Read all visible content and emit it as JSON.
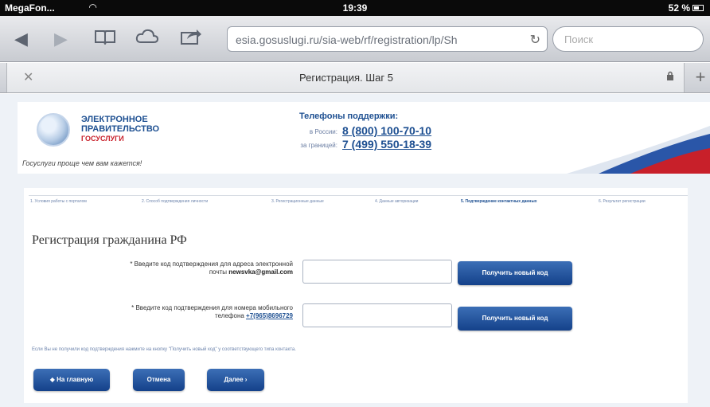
{
  "status_bar": {
    "carrier": "MegaFon...",
    "time": "19:39",
    "battery": "52 %"
  },
  "browser": {
    "url": "esia.gosuslugi.ru/sia-web/rf/registration/lp/Sh",
    "search_placeholder": "Поиск",
    "tab_title": "Регистрация. Шаг 5",
    "icons": [
      "back-icon",
      "forward-icon",
      "bookmarks-icon",
      "cloud-icon",
      "share-icon",
      "reload-icon",
      "close-icon",
      "lock-icon",
      "plus-icon"
    ]
  },
  "header": {
    "logo_line1": "ЭЛЕКТРОННОЕ",
    "logo_line2": "ПРАВИТЕЛЬСТВО",
    "logo_line3": "ГОСУСЛУГИ",
    "slogan": "Госуслуги проще чем вам кажется!",
    "phones_title": "Телефоны поддержки:",
    "phone1_label": "в России:",
    "phone1": "8 (800) 100-70-10",
    "phone2_label": "за границей:",
    "phone2": "7 (499) 550-18-39"
  },
  "steps": [
    "1. Условия работы с порталом",
    "2. Способ подтверждения личности",
    "3. Регистрационные данные",
    "4. Данные авторизации",
    "5. Подтверждение контактных данных",
    "6. Результат регистрации"
  ],
  "active_step": 5,
  "form": {
    "title": "Регистрация гражданина РФ",
    "email_label": "* Введите код подтверждения для адреса электронной почты",
    "email": "newsvka@gmail.com",
    "phone_label": "* Введите код подтверждения для номера мобильного телефона",
    "phone": "+7(965)8696729",
    "email_code_value": "",
    "phone_code_value": "",
    "get_code_label": "Получить новый код",
    "hint": "Если Вы не получили код подтверждения нажмите на кнопку \"Получить новый код\" у соответствующего типа контакта."
  },
  "nav": {
    "home_label": "◆ На главную",
    "cancel_label": "Отмена",
    "next_label": "Далее ›"
  },
  "colors": {
    "brand_blue": "#1d4f91",
    "button_blue": "#14418a",
    "red": "#c8202a",
    "page_bg": "#eef2f7"
  }
}
